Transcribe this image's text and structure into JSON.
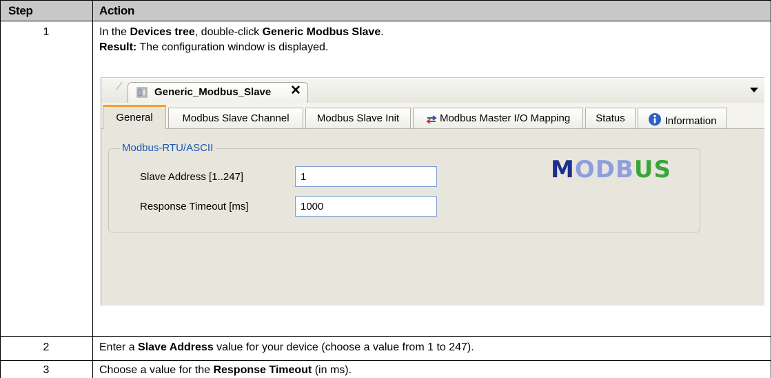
{
  "table": {
    "headers": {
      "step": "Step",
      "action": "Action"
    },
    "rows": [
      {
        "step": "1",
        "line1": {
          "pre": "In the ",
          "b1": "Devices tree",
          "mid": ", double-click ",
          "b2": "Generic Modbus Slave",
          "post": "."
        },
        "line2": {
          "b": "Result:",
          "post": " The configuration window is displayed."
        }
      },
      {
        "step": "2",
        "text": {
          "pre": "Enter a ",
          "b": "Slave Address",
          "post": " value for your device (choose a value from 1 to 247)."
        }
      },
      {
        "step": "3",
        "text": {
          "pre": "Choose a value for the ",
          "b": "Response Timeout",
          "post": " (in ms)."
        }
      }
    ]
  },
  "window": {
    "doc_tab_title": "Generic_Modbus_Slave",
    "close_glyph": "✕",
    "tabs": [
      "General",
      "Modbus Slave Channel",
      "Modbus Slave Init",
      "Modbus Master I/O Mapping",
      "Status",
      "Information"
    ],
    "active_tab": "General",
    "group_title": "Modbus-RTU/ASCII",
    "fields": [
      {
        "label": "Slave Address [1..247]",
        "value": "1"
      },
      {
        "label": "Response Timeout [ms]",
        "value": "1000"
      }
    ],
    "logo_text": "MODBUS",
    "colors": {
      "active_tab_accent": "#f0a030",
      "group_label": "#1a55b3",
      "logo_blue": "#1c2f8c",
      "logo_light": "#8e9ee0",
      "logo_green": "#3aa53a"
    }
  }
}
